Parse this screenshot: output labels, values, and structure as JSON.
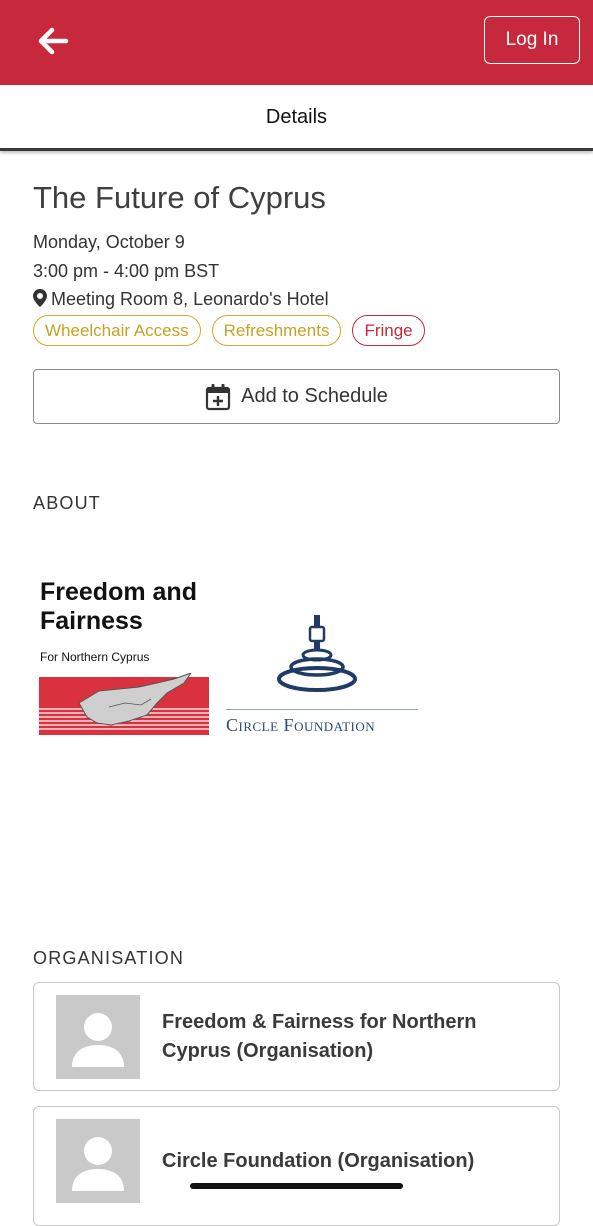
{
  "header": {
    "back_icon": "arrow-left-icon",
    "login_label": "Log In",
    "subtitle": "Details"
  },
  "colors": {
    "brand_red": "#c8283b",
    "tag_gold": "#d4a829"
  },
  "event": {
    "title": "The Future of Cyprus",
    "date": "Monday, October 9",
    "time": "3:00 pm - 4:00 pm BST",
    "location_icon": "map-pin-icon",
    "location": "Meeting Room 8, Leonardo's Hotel",
    "tags": [
      {
        "label": "Wheelchair Access",
        "color": "gold"
      },
      {
        "label": "Refreshments",
        "color": "gold"
      },
      {
        "label": "Fringe",
        "color": "red"
      }
    ],
    "add_icon": "calendar-plus-icon",
    "add_label": "Add to Schedule"
  },
  "about": {
    "heading": "ABOUT",
    "logo_left_title": "Freedom and Fairness",
    "logo_left_subtitle": "For Northern Cyprus",
    "logo_right_text": "Circle Foundation"
  },
  "organisation": {
    "heading": "ORGANISATION",
    "items": [
      {
        "name": "Freedom & Fairness for Northern Cyprus (Organisation)"
      },
      {
        "name": "Circle Foundation (Organisation)"
      }
    ]
  }
}
